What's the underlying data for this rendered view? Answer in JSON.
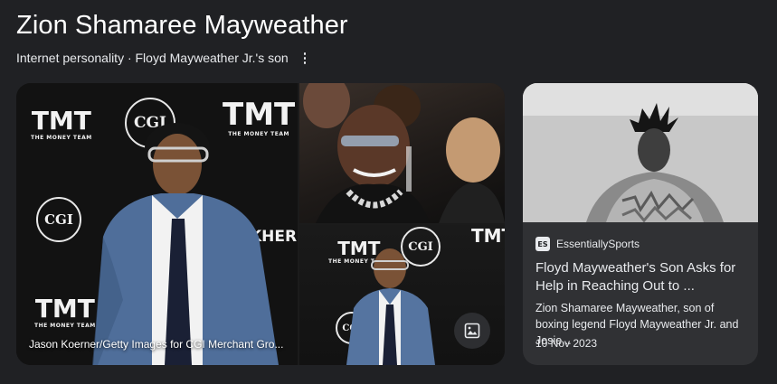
{
  "header": {
    "title": "Zion Shamaree Mayweather",
    "subtitle": "Internet personality · Floyd Mayweather Jr.'s son"
  },
  "gallery": {
    "main_caption": "Jason Koerner/Getty Images for CGI Merchant Gro...",
    "logos": {
      "tmt": "TMT",
      "tmt_tagline": "THE MONEY TEAM",
      "cgi": "CGI",
      "khertext": "KHER"
    },
    "image_button_icon": "image-icon"
  },
  "article_card": {
    "source_logo": "ES",
    "source": "EssentiallySports",
    "title": "Floyd Mayweather's Son Asks for Help in Reaching Out to ...",
    "snippet": "Zion Shamaree Mayweather, son of boxing legend Floyd Mayweather Jr. and Josie...",
    "date": "10 Nov 2023"
  },
  "colors": {
    "background": "#202124",
    "card": "#303134",
    "text": "#e8eaed"
  }
}
